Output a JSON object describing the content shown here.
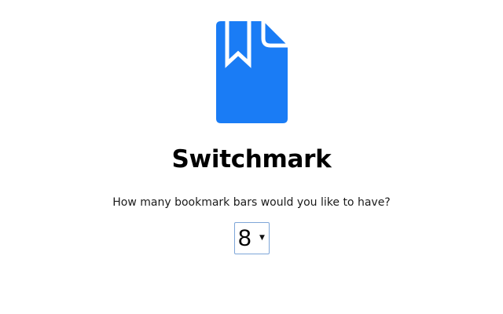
{
  "app": {
    "title": "Switchmark",
    "logo_icon": "bookmark-document-icon",
    "logo_color": "#1a7cf5"
  },
  "prompt": {
    "question": "How many bookmark bars would you like to have?"
  },
  "bar_count_select": {
    "value": "8",
    "arrow_icon": "triangle-down-icon"
  }
}
